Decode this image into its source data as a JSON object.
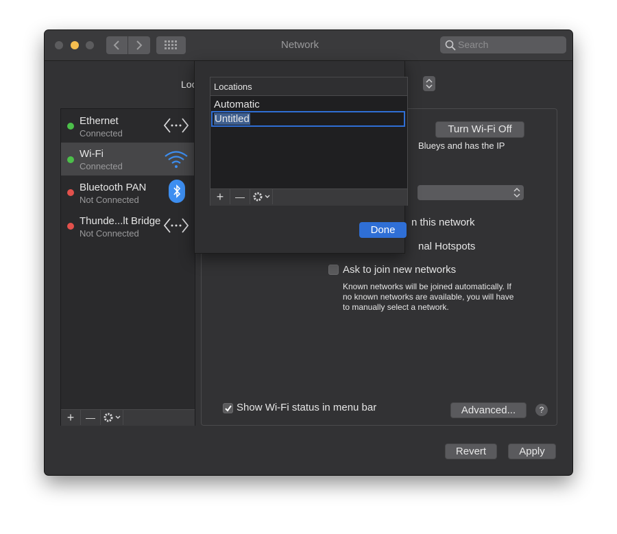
{
  "window": {
    "title": "Network"
  },
  "toolbar": {
    "search_placeholder": "Search"
  },
  "location": {
    "label_partial": "Loc"
  },
  "services": [
    {
      "name": "Ethernet",
      "status": "Connected",
      "status_color": "#4cbf4a"
    },
    {
      "name": "Wi-Fi",
      "status": "Connected",
      "status_color": "#4cbf4a"
    },
    {
      "name": "Bluetooth PAN",
      "status": "Not Connected",
      "status_color": "#e2514c"
    },
    {
      "name": "Thunde...lt Bridge",
      "status": "Not Connected",
      "status_color": "#e2514c"
    }
  ],
  "sidebar_toolbar": {
    "add": "+",
    "remove": "—"
  },
  "detail": {
    "turn_wifi_off": "Turn Wi-Fi Off",
    "ip_text_partial": "Blueys and has the IP",
    "auto_join_partial": "n this network",
    "hotspots_partial": "nal Hotspots",
    "ask_join_label": "Ask to join new networks",
    "ask_join_desc_1": "Known networks will be joined automatically. If",
    "ask_join_desc_2": "no known networks are available, you will have",
    "ask_join_desc_3": "to manually select a network.",
    "show_status_label": "Show Wi-Fi status in menu bar",
    "advanced": "Advanced...",
    "help": "?"
  },
  "footer": {
    "revert": "Revert",
    "apply": "Apply"
  },
  "locations_sheet": {
    "header": "Locations",
    "items": [
      "Automatic",
      "Untitled"
    ],
    "selected_index": 1,
    "add": "+",
    "remove": "—",
    "done": "Done"
  },
  "colors": {
    "accent": "#2f6fd6",
    "window_bg": "#323234"
  }
}
